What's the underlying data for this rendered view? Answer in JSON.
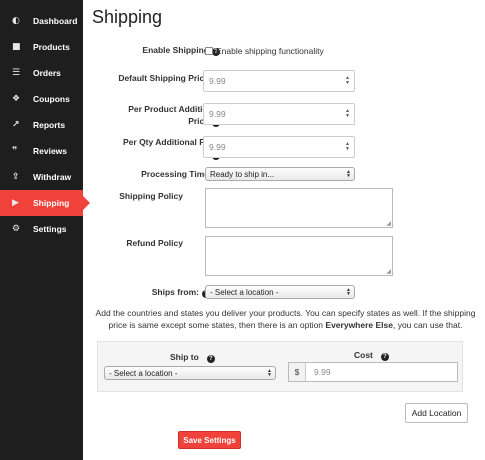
{
  "sidebar": {
    "items": [
      {
        "label": "Dashboard",
        "icon": "dashboard-icon",
        "glyph": "◐"
      },
      {
        "label": "Products",
        "icon": "briefcase-icon",
        "glyph": "■"
      },
      {
        "label": "Orders",
        "icon": "cart-icon",
        "glyph": "☰"
      },
      {
        "label": "Coupons",
        "icon": "gift-icon",
        "glyph": "❖"
      },
      {
        "label": "Reports",
        "icon": "chart-icon",
        "glyph": "↗"
      },
      {
        "label": "Reviews",
        "icon": "comments-icon",
        "glyph": "❞"
      },
      {
        "label": "Withdraw",
        "icon": "upload-icon",
        "glyph": "⇪"
      },
      {
        "label": "Shipping",
        "icon": "truck-icon",
        "glyph": "▶"
      },
      {
        "label": "Settings",
        "icon": "gear-icon",
        "glyph": "⚙"
      }
    ],
    "active": "Shipping",
    "active_color": "#f0413a",
    "background": "#1e1e1e"
  },
  "page": {
    "title": "Shipping"
  },
  "form": {
    "enable_shipping": {
      "label": "Enable Shipping",
      "checkbox_label": "Enable shipping functionality",
      "checked": false
    },
    "default_price": {
      "label": "Default Shipping Price",
      "placeholder": "9.99"
    },
    "per_product": {
      "label_line1": "Per Product Additional",
      "label_line2": "Price",
      "placeholder": "9.99"
    },
    "per_qty": {
      "label": "Per Qty Additional Price",
      "placeholder": "9.99"
    },
    "processing_time": {
      "label": "Processing Time",
      "selected": "Ready to ship in..."
    },
    "shipping_policy": {
      "label": "Shipping Policy"
    },
    "refund_policy": {
      "label": "Refund Policy"
    },
    "ships_from": {
      "label": "Ships from:",
      "selected": "- Select a location -"
    }
  },
  "description": {
    "part1": "Add the countries and states you deliver your products. You can specify states as well. If the shipping price is same except some states, then there is an option ",
    "bold": "Everywhere Else",
    "part2": ", you can use that."
  },
  "locations": {
    "ship_to_header": "Ship to",
    "cost_header": "Cost",
    "ship_to_selected": "- Select a location -",
    "currency": "$",
    "cost_placeholder": "9.99"
  },
  "buttons": {
    "add_location": "Add Location",
    "save_settings": "Save Settings"
  },
  "help_glyph": "?"
}
